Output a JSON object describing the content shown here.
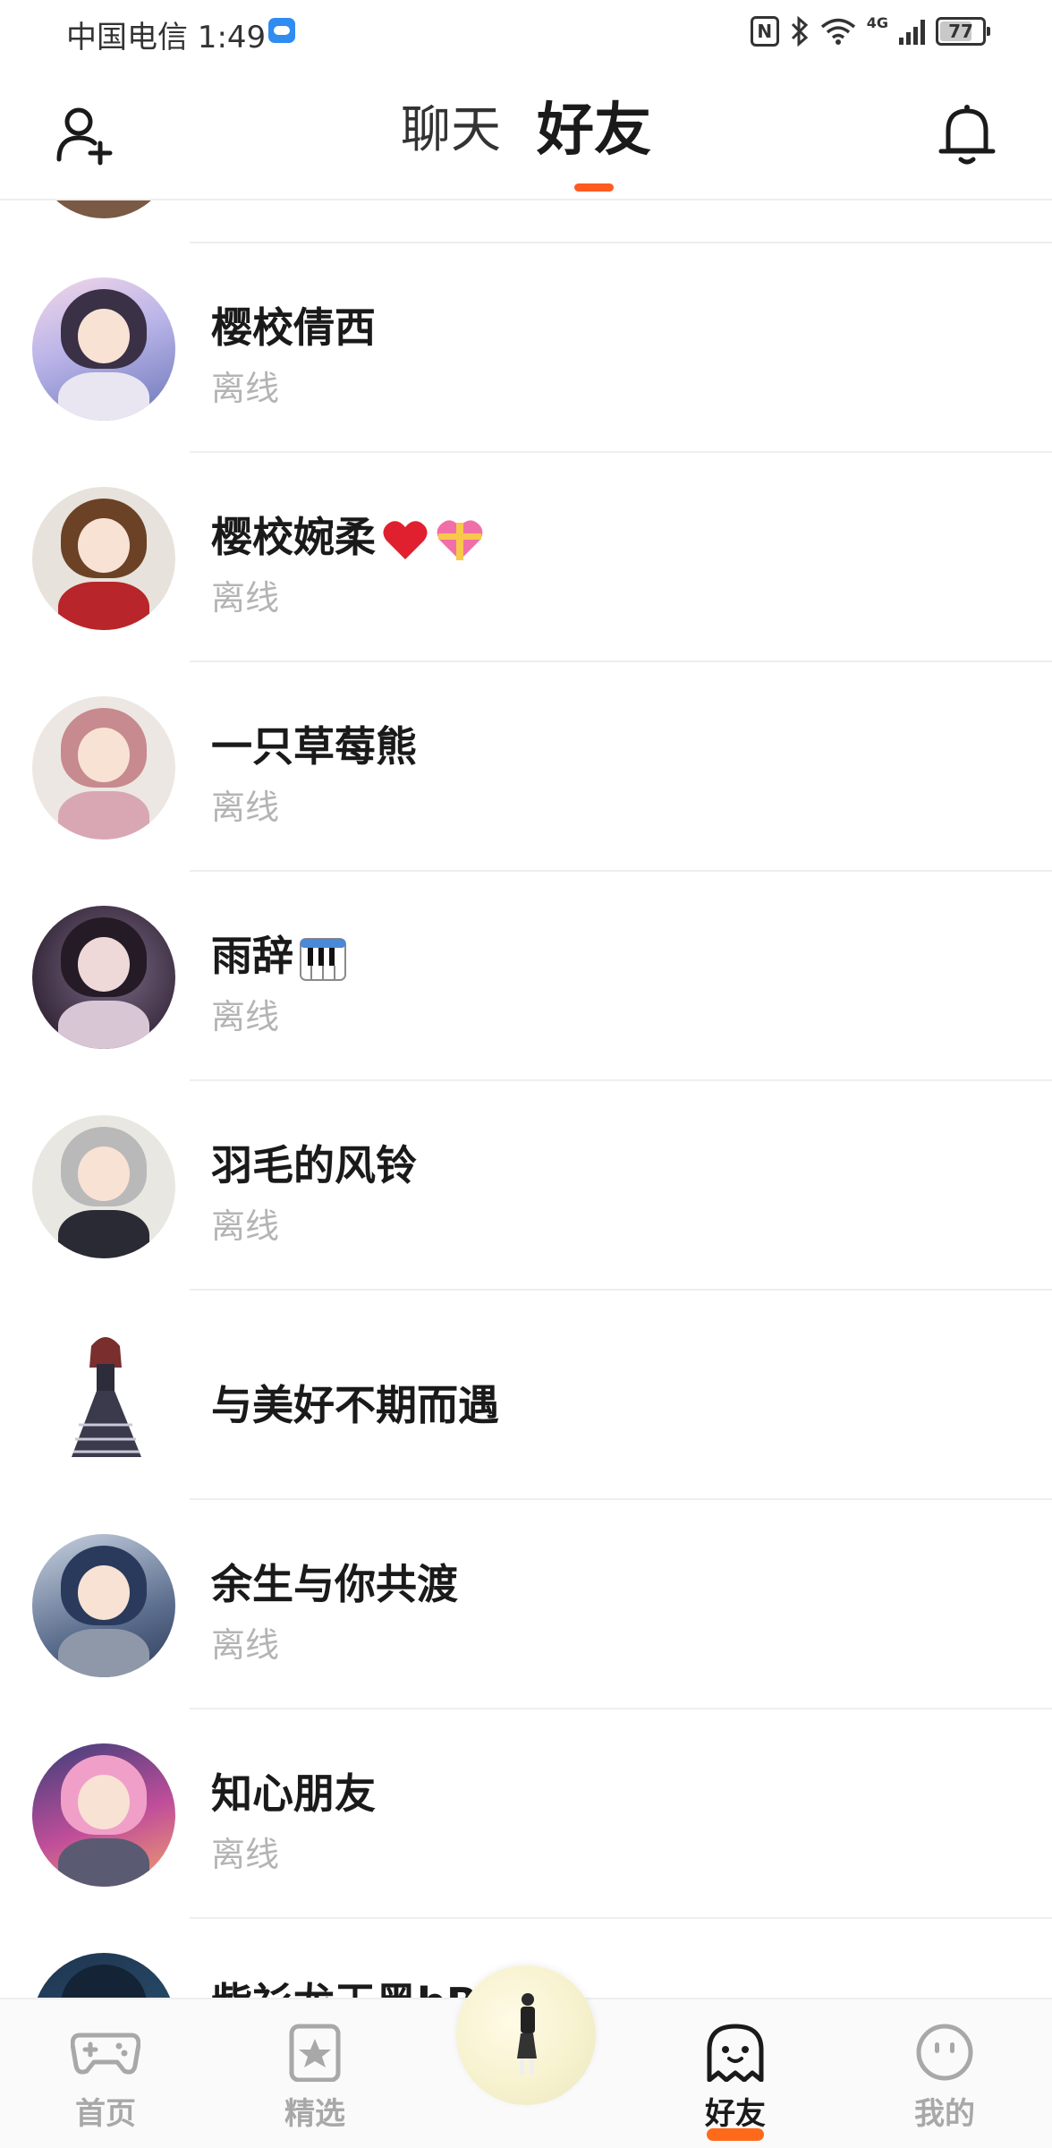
{
  "status_bar": {
    "carrier_time": "中国电信 1:49",
    "network": "4G",
    "battery": "77",
    "battery_level": 0.77
  },
  "header": {
    "tabs": [
      {
        "label": "聊天",
        "active": false
      },
      {
        "label": "好友",
        "active": true
      }
    ],
    "icons": {
      "left": "add-friend-icon",
      "right": "bell-icon"
    },
    "accent_color": "#ff5a1f"
  },
  "friends": [
    {
      "name": "樱校倩西",
      "emoji": "",
      "status": "离线"
    },
    {
      "name": "樱校婉柔",
      "emoji": "heart-gift",
      "status": "离线"
    },
    {
      "name": "一只草莓熊",
      "emoji": "",
      "status": "离线"
    },
    {
      "name": "雨辞",
      "emoji": "piano",
      "status": "离线"
    },
    {
      "name": "羽毛的风铃",
      "emoji": "",
      "status": "离线"
    },
    {
      "name": "与美好不期而遇",
      "emoji": "",
      "status": ""
    },
    {
      "name": "余生与你共渡",
      "emoji": "",
      "status": "离线"
    },
    {
      "name": "知心朋友",
      "emoji": "",
      "status": "离线"
    },
    {
      "name": "紫衫龙王黑bB",
      "emoji": "",
      "status": ""
    }
  ],
  "bottom_nav": {
    "items": [
      {
        "label": "首页",
        "icon": "gamepad-icon",
        "active": false
      },
      {
        "label": "精选",
        "icon": "star-bookmark-icon",
        "active": false
      },
      {
        "label": "好友",
        "icon": "ghost-icon",
        "active": true
      },
      {
        "label": "我的",
        "icon": "smiley-icon",
        "active": false
      }
    ],
    "active_color": "#ff6a1a"
  }
}
